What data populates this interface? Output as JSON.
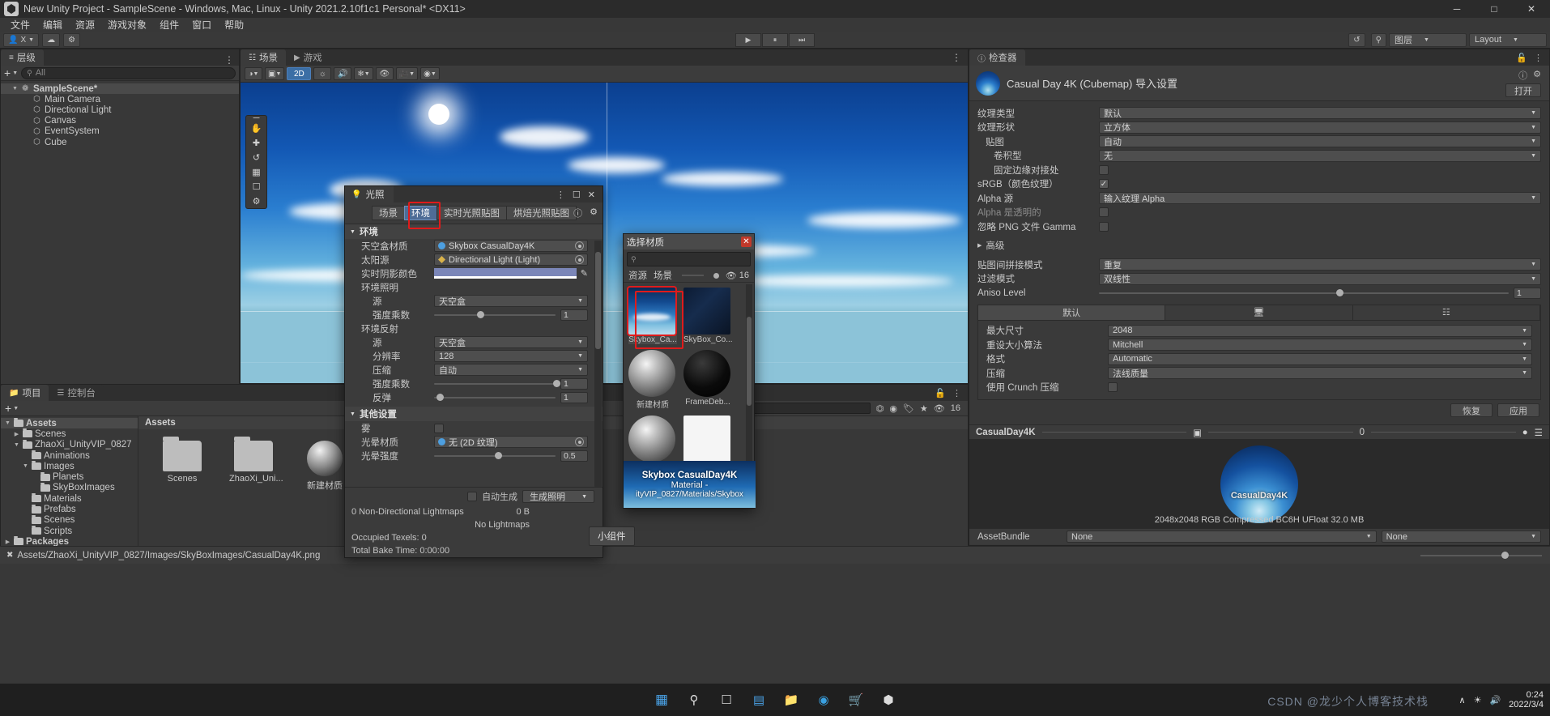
{
  "window": {
    "title": "New Unity Project - SampleScene - Windows, Mac, Linux - Unity 2021.2.10f1c1 Personal* <DX11>",
    "minimize": "─",
    "maximize": "□",
    "close": "✕"
  },
  "menu": {
    "items": [
      "文件",
      "编辑",
      "资源",
      "游戏对象",
      "组件",
      "窗口",
      "帮助"
    ]
  },
  "toolbar": {
    "account": "X",
    "cloud_icon": "cloud-icon",
    "collab_icon": "collab-icon",
    "play": "▶",
    "pause": "⏸",
    "step": "⏭",
    "undo_icon": "↺",
    "search_icon": "⚲",
    "layers_label": "图层",
    "layout_label": "Layout"
  },
  "hierarchy": {
    "tab": "层级",
    "add_label": "+",
    "search_placeholder": "All",
    "items": [
      {
        "label": "SampleScene*",
        "depth": 0,
        "selected": true,
        "icon": "scene-icon"
      },
      {
        "label": "Main Camera",
        "depth": 1,
        "selected": false,
        "icon": "gameobject-icon"
      },
      {
        "label": "Directional Light",
        "depth": 1,
        "selected": false,
        "icon": "gameobject-icon"
      },
      {
        "label": "Canvas",
        "depth": 1,
        "selected": false,
        "icon": "gameobject-icon"
      },
      {
        "label": "EventSystem",
        "depth": 1,
        "selected": false,
        "icon": "gameobject-icon"
      },
      {
        "label": "Cube",
        "depth": 1,
        "selected": false,
        "icon": "gameobject-icon"
      }
    ]
  },
  "scene": {
    "tab_scene": "场景",
    "tab_game": "游戏",
    "shading_mode": "着色模式",
    "twod_label": "2D",
    "tools": [
      "hand-tool",
      "move-tool",
      "rotate-tool",
      "scale-tool",
      "rect-tool",
      "transform-tool"
    ],
    "gizmo_label": "Gizmos"
  },
  "lighting": {
    "title": "光照",
    "tabs": [
      {
        "label": "场景",
        "active": false
      },
      {
        "label": "环境",
        "active": true
      },
      {
        "label": "实时光照贴图",
        "active": false
      },
      {
        "label": "烘焙光照贴图",
        "active": false
      }
    ],
    "section_environment": "环境",
    "rows": [
      {
        "label": "天空盒材质",
        "indent": 0,
        "type": "object",
        "value": "Skybox CasualDay4K",
        "icon": "material-icon"
      },
      {
        "label": "太阳源",
        "indent": 0,
        "type": "object",
        "value": "Directional Light (Light)",
        "icon": "light-icon"
      },
      {
        "label": "实时阴影颜色",
        "indent": 0,
        "type": "color",
        "value": "#7b86b8"
      },
      {
        "label": "环境照明",
        "indent": 0,
        "type": "group"
      },
      {
        "label": "源",
        "indent": 1,
        "type": "dropdown",
        "value": "天空盒"
      },
      {
        "label": "强度乘数",
        "indent": 1,
        "type": "slider",
        "value": "1",
        "pos": 0.35
      },
      {
        "label": "环境反射",
        "indent": 0,
        "type": "group"
      },
      {
        "label": "源",
        "indent": 1,
        "type": "dropdown",
        "value": "天空盒"
      },
      {
        "label": "分辨率",
        "indent": 1,
        "type": "dropdown",
        "value": "128"
      },
      {
        "label": "压缩",
        "indent": 1,
        "type": "dropdown",
        "value": "自动"
      },
      {
        "label": "强度乘数",
        "indent": 1,
        "type": "slider",
        "value": "1",
        "pos": 0.98
      },
      {
        "label": "反弹",
        "indent": 1,
        "type": "slider",
        "value": "1",
        "pos": 0.02
      }
    ],
    "section_other": "其他设置",
    "other_rows": [
      {
        "label": "雾",
        "indent": 0,
        "type": "checkbox",
        "value": false
      },
      {
        "label": "光晕材质",
        "indent": 0,
        "type": "object",
        "value": "无 (2D 纹理)"
      },
      {
        "label": "光晕强度",
        "indent": 0,
        "type": "slider",
        "value": "0.5",
        "pos": 0.5
      }
    ],
    "auto_generate": "自动生成",
    "generate_button": "生成照明",
    "stat_lightmaps": "0 Non-Directional Lightmaps",
    "stat_size": "0 B",
    "stat_nolightmaps": "No Lightmaps",
    "stat_occupied": "Occupied Texels: 0",
    "stat_bake": "Total Bake Time: 0:00:00",
    "help_icon": "help-icon",
    "settings_icon": "gear-icon"
  },
  "material_picker": {
    "title": "选择材质",
    "close": "✕",
    "search_placeholder": "",
    "tab_assets": "资源",
    "tab_scene": "场景",
    "zoom_value": "16",
    "items": [
      {
        "name": "Skybox_Ca...",
        "swatch": "sky",
        "selected": true
      },
      {
        "name": "SkyBox_Co...",
        "swatch": "dark",
        "selected": false
      },
      {
        "name": "新建材质",
        "swatch": "ball",
        "selected": false
      },
      {
        "name": "FrameDeb...",
        "swatch": "black",
        "selected": false
      },
      {
        "name": "",
        "swatch": "ball",
        "selected": false
      },
      {
        "name": "",
        "swatch": "white",
        "selected": false
      }
    ],
    "preview_title": "Skybox CasualDay4K",
    "preview_sub": "Material -",
    "preview_path": "ityVIP_0827/Materials/Skybox"
  },
  "project": {
    "tab_project": "项目",
    "tab_console": "控制台",
    "add_label": "+",
    "breadcrumb": "Assets",
    "tree": [
      {
        "label": "Assets",
        "depth": 0,
        "expanded": true,
        "selected": true
      },
      {
        "label": "Scenes",
        "depth": 1,
        "expanded": false,
        "selected": false
      },
      {
        "label": "ZhaoXi_UnityVIP_0827",
        "depth": 1,
        "expanded": true,
        "selected": false
      },
      {
        "label": "Animations",
        "depth": 2,
        "expanded": false,
        "selected": false
      },
      {
        "label": "Images",
        "depth": 2,
        "expanded": true,
        "selected": false
      },
      {
        "label": "Planets",
        "depth": 3,
        "expanded": false,
        "selected": false
      },
      {
        "label": "SkyBoxImages",
        "depth": 3,
        "expanded": false,
        "selected": false
      },
      {
        "label": "Materials",
        "depth": 2,
        "expanded": false,
        "selected": false
      },
      {
        "label": "Prefabs",
        "depth": 2,
        "expanded": false,
        "selected": false
      },
      {
        "label": "Scenes",
        "depth": 2,
        "expanded": false,
        "selected": false
      },
      {
        "label": "Scripts",
        "depth": 2,
        "expanded": false,
        "selected": false
      },
      {
        "label": "Packages",
        "depth": 0,
        "expanded": false,
        "selected": false
      }
    ],
    "assets": [
      {
        "label": "Scenes",
        "type": "folder"
      },
      {
        "label": "ZhaoXi_Uni...",
        "type": "folder"
      },
      {
        "label": "新建材质",
        "type": "material"
      }
    ],
    "zoom_value": "16"
  },
  "inspector": {
    "tab": "检查器",
    "asset_title": "Casual Day 4K (Cubemap)  导入设置",
    "open_button": "打开",
    "rows": [
      {
        "label": "纹理类型",
        "indent": 0,
        "type": "dropdown",
        "value": "默认"
      },
      {
        "label": "纹理形状",
        "indent": 0,
        "type": "dropdown",
        "value": "立方体"
      },
      {
        "label": "贴图",
        "indent": 1,
        "type": "dropdown",
        "value": "自动"
      },
      {
        "label": "卷积型",
        "indent": 2,
        "type": "dropdown",
        "value": "无"
      },
      {
        "label": "固定边缘对接处",
        "indent": 2,
        "type": "checkbox",
        "value": false
      },
      {
        "label": "sRGB（颜色纹理）",
        "indent": 0,
        "type": "checkbox",
        "value": true
      },
      {
        "label": "Alpha 源",
        "indent": 0,
        "type": "dropdown",
        "value": "输入纹理 Alpha"
      },
      {
        "label": "Alpha 是透明的",
        "indent": 0,
        "type": "checkbox",
        "value": false,
        "dim": true
      },
      {
        "label": "忽略 PNG 文件 Gamma",
        "indent": 0,
        "type": "checkbox",
        "value": false
      }
    ],
    "advanced_label": "高级",
    "rows2": [
      {
        "label": "贴图间拼接模式",
        "indent": 0,
        "type": "dropdown",
        "value": "重复"
      },
      {
        "label": "过滤模式",
        "indent": 0,
        "type": "dropdown",
        "value": "双线性"
      },
      {
        "label": "Aniso Level",
        "indent": 0,
        "type": "slider",
        "value": "1",
        "pos": 0.58
      }
    ],
    "platform_tabs": [
      {
        "label": "默认",
        "active": true
      },
      {
        "label": "standalone-icon",
        "active": false
      },
      {
        "label": "android-icon",
        "active": false
      }
    ],
    "platform_rows": [
      {
        "label": "最大尺寸",
        "type": "dropdown",
        "value": "2048"
      },
      {
        "label": "重设大小算法",
        "type": "dropdown",
        "value": "Mitchell"
      },
      {
        "label": "格式",
        "type": "dropdown",
        "value": "Automatic"
      },
      {
        "label": "压缩",
        "type": "dropdown",
        "value": "法线质量"
      },
      {
        "label": "使用 Crunch 压缩",
        "type": "checkbox",
        "value": false
      }
    ],
    "revert_button": "恢复",
    "apply_button": "应用",
    "preview_name": "CasualDay4K",
    "preview_mip": "0",
    "preview_caption": "CasualDay4K",
    "preview_info": "2048x2048  RGB Compressed BC6H UFloat   32.0 MB",
    "assetbundle_label": "AssetBundle",
    "assetbundle_value": "None",
    "assetbundle_variant": "None"
  },
  "statusbar": {
    "path": "Assets/ZhaoXi_UnityVIP_0827/Images/SkyBoxImages/CasualDay4K.png",
    "widget_tooltip": "小组件"
  },
  "taskbar": {
    "icons": [
      "start-icon",
      "search-icon",
      "taskview-icon",
      "widgets-icon",
      "explorer-icon",
      "edge-icon",
      "store-icon",
      "unity-icon"
    ],
    "clock_time": "0:24",
    "clock_date": "2022/3/4",
    "watermark": "CSDN @龙少个人博客技术栈",
    "tray": "∧"
  }
}
